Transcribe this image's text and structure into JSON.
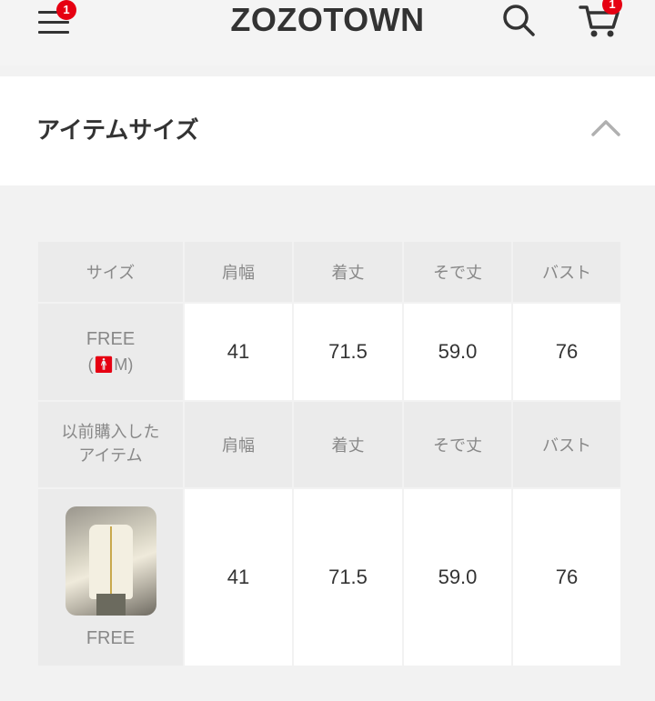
{
  "header": {
    "logo": "ZOZOTOWN",
    "menu_badge": "1",
    "cart_badge": "1",
    "menu_icon": "hamburger-menu-icon",
    "search_icon": "search-icon",
    "cart_icon": "cart-icon"
  },
  "section": {
    "title": "アイテムサイズ",
    "toggle_icon": "chevron-up-icon"
  },
  "table": {
    "headers": [
      "サイズ",
      "肩幅",
      "着丈",
      "そで丈",
      "バスト"
    ],
    "row1": {
      "size": "FREE",
      "model_open": "(",
      "model_size": "M",
      "model_close": ")",
      "values": [
        "41",
        "71.5",
        "59.0",
        "76"
      ]
    },
    "headers2": {
      "label_line1": "以前購入した",
      "label_line2": "アイテム",
      "cols": [
        "肩幅",
        "着丈",
        "そで丈",
        "バスト"
      ]
    },
    "row2": {
      "size": "FREE",
      "values": [
        "41",
        "71.5",
        "59.0",
        "76"
      ]
    }
  },
  "colors": {
    "badge": "#e60012",
    "text": "#333333",
    "muted": "#888888",
    "header_cell": "#ebebeb"
  }
}
